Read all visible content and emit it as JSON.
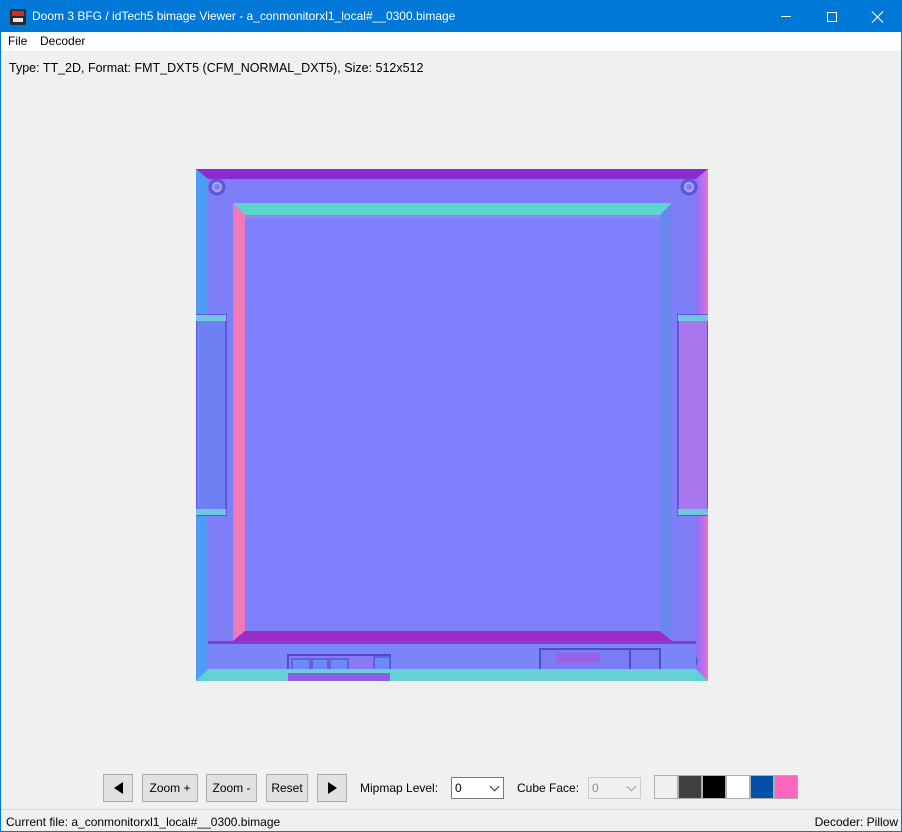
{
  "window": {
    "title": "Doom 3 BFG / idTech5 bimage Viewer - a_conmonitorxl1_local#__0300.bimage"
  },
  "menu": {
    "file": "File",
    "decoder": "Decoder"
  },
  "info": {
    "text": "Type: TT_2D, Format: FMT_DXT5 (CFM_NORMAL_DXT5), Size: 512x512"
  },
  "toolbar": {
    "zoom_in": "Zoom +",
    "zoom_out": "Zoom -",
    "reset": "Reset",
    "mipmap_label": "Mipmap Level:",
    "mipmap_value": "0",
    "cube_face_label": "Cube Face:",
    "cube_face_value": "0",
    "background_swatches": [
      "#f0f0f0",
      "#404040",
      "#000000",
      "#ffffff",
      "#0050a8",
      "#ff66bb"
    ]
  },
  "status": {
    "current_file": "Current file: a_conmonitorxl1_local#__0300.bimage",
    "decoder": "Decoder: Pillow"
  },
  "icons": {
    "app": "doom-app-icon",
    "prev": "triangle-left-icon",
    "next": "triangle-right-icon"
  }
}
